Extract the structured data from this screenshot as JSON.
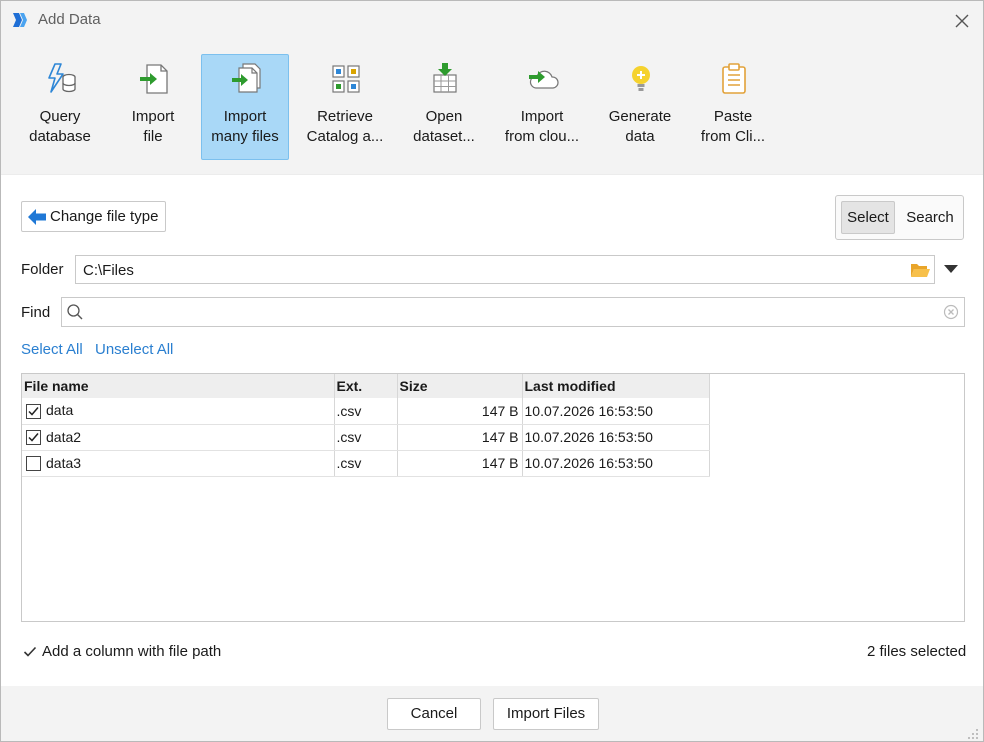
{
  "window": {
    "title": "Add Data"
  },
  "ribbon": {
    "items": [
      {
        "line1": "Query",
        "line2": "database",
        "icon": "query-database-icon"
      },
      {
        "line1": "Import",
        "line2": "file",
        "icon": "import-file-icon"
      },
      {
        "line1": "Import",
        "line2": "many files",
        "icon": "import-many-files-icon",
        "active": true
      },
      {
        "line1": "Retrieve",
        "line2": "Catalog a...",
        "icon": "catalog-icon"
      },
      {
        "line1": "Open",
        "line2": "dataset...",
        "icon": "open-dataset-icon"
      },
      {
        "line1": "Import",
        "line2": "from clou...",
        "icon": "import-cloud-icon"
      },
      {
        "line1": "Generate",
        "line2": "data",
        "icon": "lightbulb-icon"
      },
      {
        "line1": "Paste",
        "line2": "from Cli...",
        "icon": "clipboard-icon"
      }
    ]
  },
  "change_file_type": "Change file type",
  "mode": {
    "select": "Select",
    "search": "Search",
    "selected": "Select"
  },
  "folder": {
    "label": "Folder",
    "value": "C:\\Files"
  },
  "find": {
    "label": "Find",
    "value": ""
  },
  "links": {
    "select_all": "Select All",
    "unselect_all": "Unselect All"
  },
  "table": {
    "headers": [
      "File name",
      "Ext.",
      "Size",
      "Last modified"
    ],
    "rows": [
      {
        "checked": true,
        "name": "data",
        "ext": ".csv",
        "size": "147 B",
        "modified": "10.07.2026 16:53:50"
      },
      {
        "checked": true,
        "name": "data2",
        "ext": ".csv",
        "size": "147 B",
        "modified": "10.07.2026 16:53:50"
      },
      {
        "checked": false,
        "name": "data3",
        "ext": ".csv",
        "size": "147 B",
        "modified": "10.07.2026 16:53:50"
      }
    ]
  },
  "add_column": {
    "label": "Add a column with file path",
    "checked": true
  },
  "status": "2 files selected",
  "footer": {
    "cancel": "Cancel",
    "import": "Import Files"
  },
  "colors": {
    "accent_blue": "#2a7fd0",
    "active_tile": "#a9d8f7",
    "green_arrow": "#2e9b2e"
  }
}
